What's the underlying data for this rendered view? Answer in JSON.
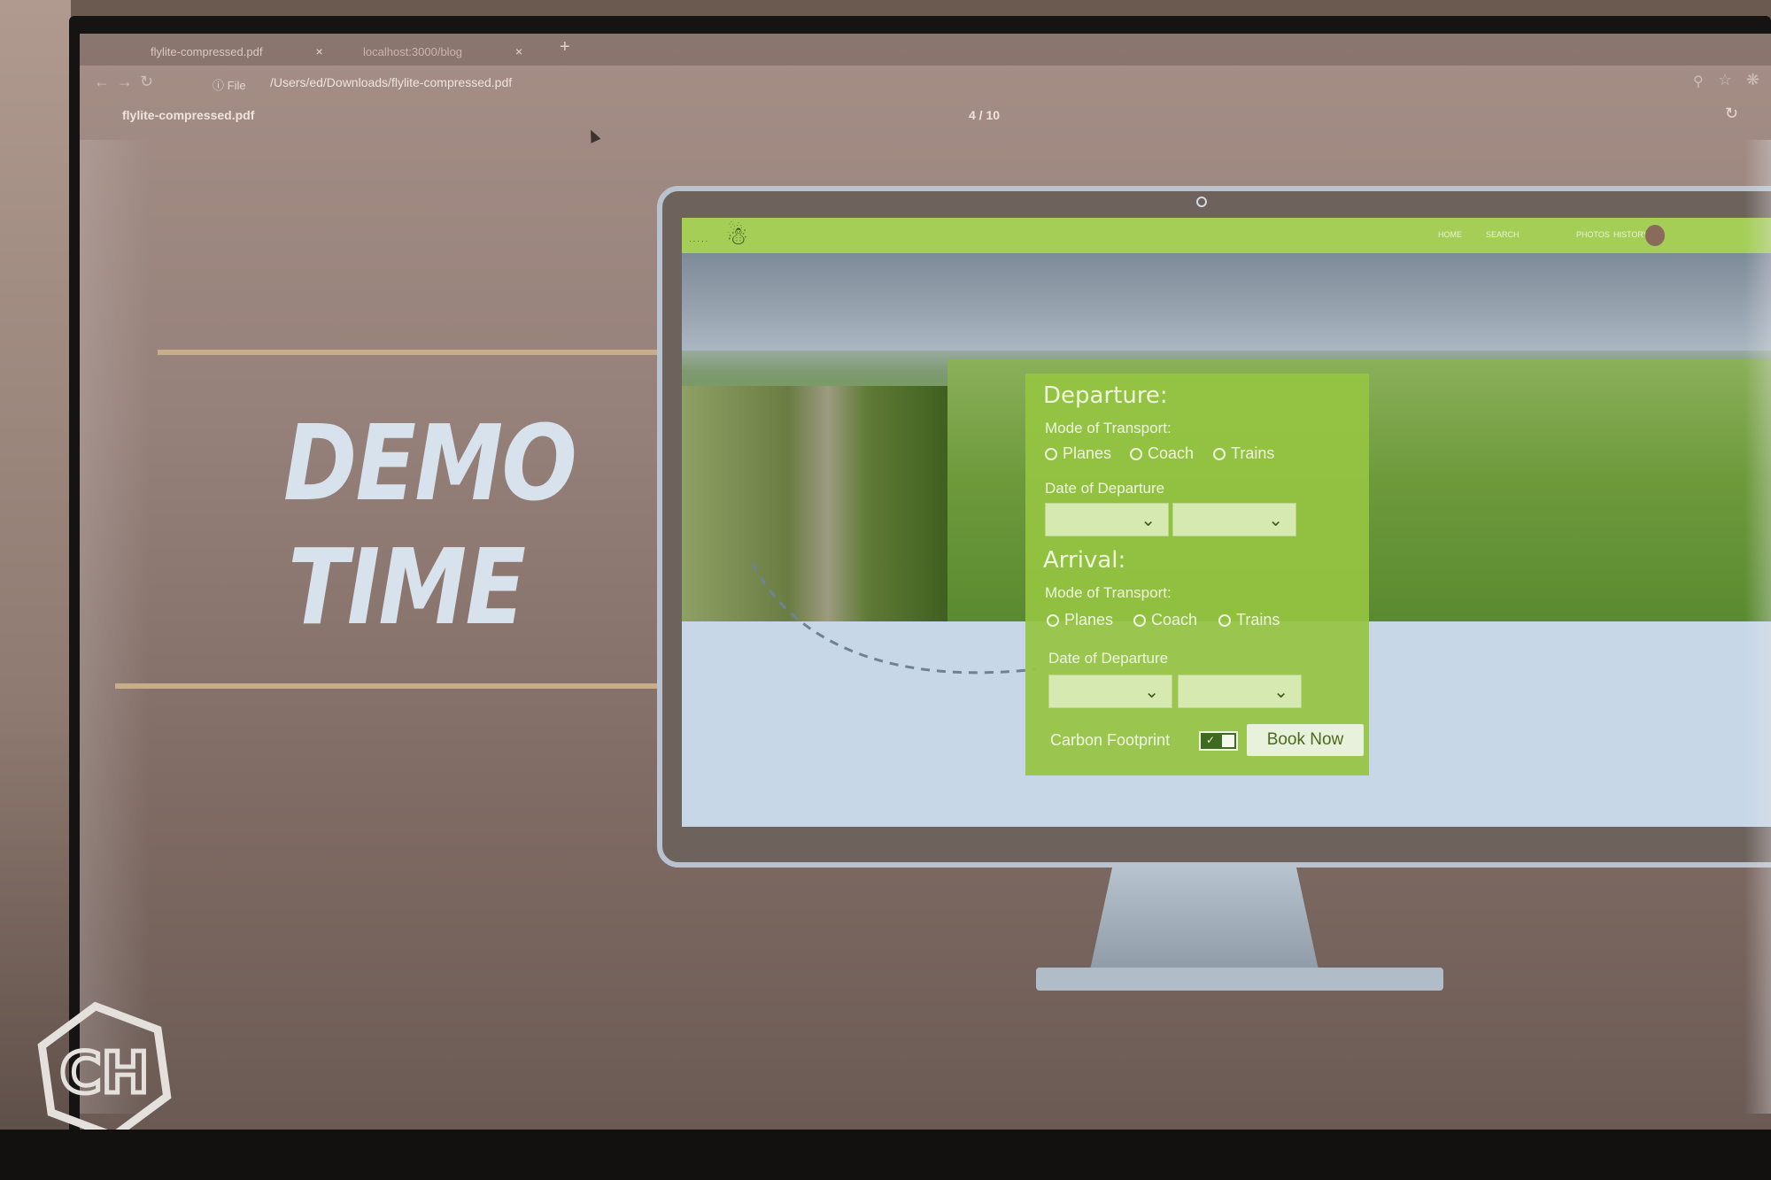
{
  "browser": {
    "tabs": [
      {
        "label": "flylite-compressed.pdf",
        "close": "×"
      },
      {
        "label": "localhost:3000/blog",
        "close": "×"
      }
    ],
    "new_tab": "+",
    "address": {
      "scheme_label": "File",
      "path": "/Users/ed/Downloads/flylite-compressed.pdf"
    },
    "icons": [
      "back-arrow-icon",
      "forward-arrow-icon",
      "reload-icon",
      "info-icon",
      "zoom-icon",
      "star-icon",
      "extension-icon"
    ]
  },
  "pdf_viewer": {
    "title": "flylite-compressed.pdf",
    "page_indicator": "4 / 10"
  },
  "slide": {
    "heading_line1": "DEMO",
    "heading_line2": "TIME",
    "accent_color": "#c8ad8a"
  },
  "website": {
    "nav": {
      "links": [
        "HOME",
        "SEARCH",
        "PHOTOS",
        "HISTORY"
      ]
    },
    "brand_color": "#a5ce57",
    "booking": {
      "departure_heading": "Departure:",
      "departure_mode_label": "Mode of Transport:",
      "departure_options": [
        "Planes",
        "Coach",
        "Trains"
      ],
      "departure_date_label": "Date of Departure",
      "arrival_heading": "Arrival:",
      "arrival_mode_label": "Mode of Transport:",
      "arrival_options": [
        "Planes",
        "Coach",
        "Trains"
      ],
      "arrival_date_label": "Date of Departure",
      "carbon_label": "Carbon Footprint",
      "book_button": "Book Now"
    }
  }
}
